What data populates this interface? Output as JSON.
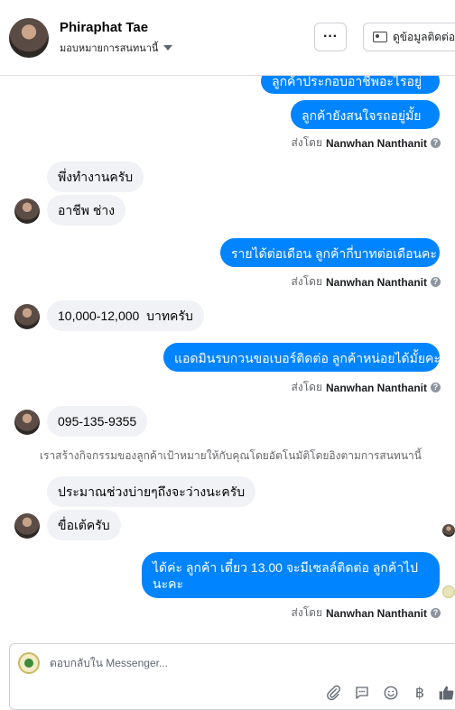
{
  "header": {
    "name": "Phiraphat Tae",
    "assign_label": "มอบหมายการสนทนานี้",
    "more_label": "···",
    "contact_label": "ดูข้อมูลติดต่อ"
  },
  "messages": {
    "m1": "ลูกค้าประกอบอาชีพอะไรอยู่คะ",
    "m2": "ลูกค้ายังสนใจรถอยู่มั้ยคะ",
    "m3": "พึ่งทำงานครับ",
    "m4": "อาชีพ ช่าง",
    "m5": "รายได้ต่อเดือน ลูกค้ากี่บาทต่อเดือนคะ",
    "m6": "10,000-12,000  บาทครับ",
    "m7": "แอดมินรบกวนขอเบอร์ติดต่อ ลูกค้าหน่อยได้มั้ยคะ",
    "m8": "095-135-9355",
    "m9": "ประมาณช่วงบ่ายๆถึงจะว่างนะครับ",
    "m10": "ขื่อเต้ครับ",
    "m11": "ได้ค่ะ ลูกค้า เดี๋ยว 13.00 จะมีเซลล์ติดต่อ ลูกค้าไปนะคะ"
  },
  "sent_by": {
    "label": "ส่งโดย",
    "agent": "Nanwhan Nanthanit"
  },
  "system_note": "เราสร้างกิจกรรมของลูกค้าเป้าหมายให้กับคุณโดยอัตโนมัติโดยอิงตามการสนทนานี้",
  "composer": {
    "placeholder": "ตอบกลับใน Messenger..."
  },
  "colors": {
    "outgoing_bubble": "#0084ff",
    "incoming_bubble": "#f0f2f5",
    "meta_text": "#65676b"
  },
  "icons": [
    "ellipsis-icon",
    "contact-card-icon",
    "caret-down-icon",
    "info-icon",
    "attachment-icon",
    "saved-reply-icon",
    "emoji-icon",
    "baht-icon",
    "thumbs-up-icon"
  ]
}
